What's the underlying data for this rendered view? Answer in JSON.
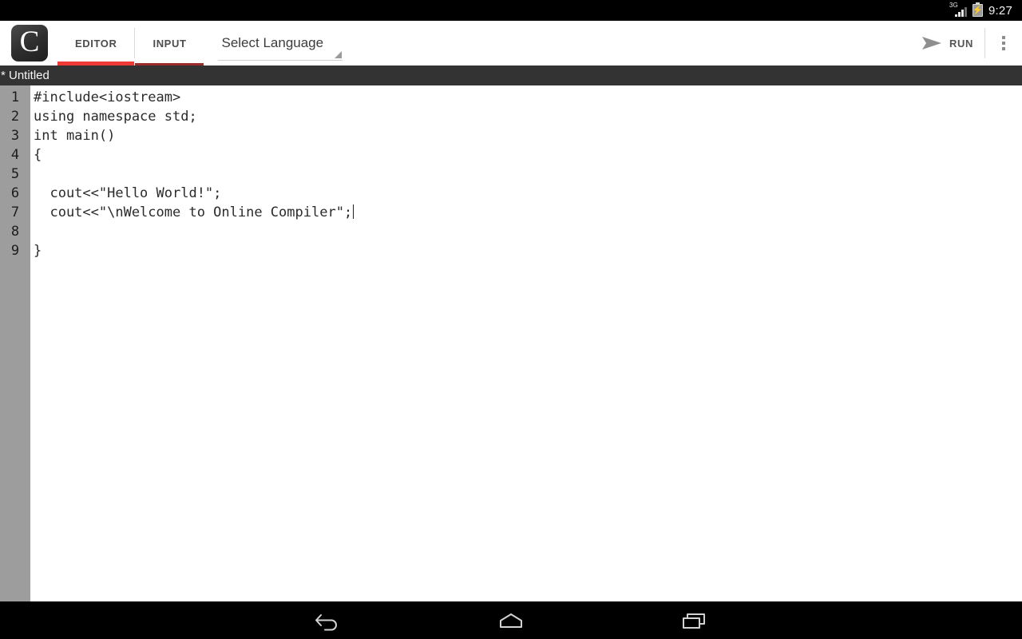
{
  "status_bar": {
    "network_label": "3G",
    "battery_icon": "battery-charging-icon",
    "signal_icon": "signal-bars-icon",
    "time": "9:27"
  },
  "action_bar": {
    "logo_letter": "C",
    "logo_name": "app-logo-c",
    "tabs": [
      {
        "label": "EDITOR",
        "selected": true
      },
      {
        "label": "INPUT",
        "selected": false
      }
    ],
    "language_spinner": {
      "value": "Select Language",
      "caret_icon": "dropdown-caret-icon"
    },
    "run": {
      "label": "RUN",
      "icon": "play-send-arrow-icon"
    },
    "overflow": {
      "icon": "overflow-menu-icon"
    }
  },
  "file_bar": {
    "title": "* Untitled"
  },
  "editor": {
    "line_numbers": [
      "1",
      "2",
      "3",
      "4",
      "5",
      "6",
      "7",
      "8",
      "9"
    ],
    "lines": [
      "#include<iostream>",
      "using namespace std;",
      "int main()",
      "{",
      "",
      "  cout<<\"Hello World!\";",
      "  cout<<\"\\nWelcome to Online Compiler\";",
      "",
      "}"
    ],
    "caret_line_index": 6
  },
  "nav_bar": {
    "buttons": [
      {
        "name": "back-icon"
      },
      {
        "name": "home-icon"
      },
      {
        "name": "recents-icon"
      }
    ]
  },
  "colors": {
    "accent_red": "#f03a35",
    "accent_red_dim": "#9c2c29",
    "file_bar_bg": "#333333",
    "gutter_bg": "#9d9d9d",
    "action_bar_bg": "#ffffff",
    "system_bar_bg": "#000000"
  }
}
